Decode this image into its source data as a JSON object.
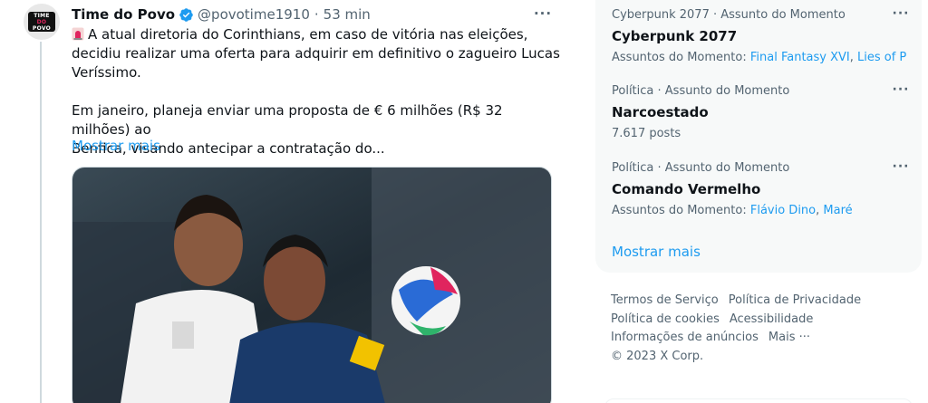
{
  "tweet": {
    "author_name": "Time do Povo",
    "handle": "@povotime1910",
    "separator": "·",
    "time": "53 min",
    "text_p1": "A atual diretoria do Corinthians, em caso de vitória nas eleições,\ndecidiu realizar uma oferta para adquirir em definitivo o zagueiro Lucas\nVeríssimo.",
    "text_p2": "Em janeiro, planeja enviar uma proposta de € 6 milhões (R$ 32 milhões) ao\nBenfica, visando antecipar a contratação do...",
    "show_more": "Mostrar mais",
    "more_icon": "more-horizontal-icon",
    "verified_icon": "verified-badge-icon",
    "alarm_icon": "rotating-light-icon",
    "avatar_lines": [
      "TIME",
      "DO",
      "POVO"
    ]
  },
  "trends": {
    "items": [
      {
        "meta": "Cyberpunk 2077 · Assunto do Momento",
        "title": "Cyberpunk 2077",
        "sub_prefix": "Assuntos do Momento: ",
        "links": [
          "Final Fantasy XVI",
          "Lies of P"
        ]
      },
      {
        "meta": "Política · Assunto do Momento",
        "title": "Narcoestado",
        "posts": "7.617 posts"
      },
      {
        "meta": "Política · Assunto do Momento",
        "title": "Comando Vermelho",
        "sub_prefix": "Assuntos do Momento: ",
        "links": [
          "Flávio Dino",
          "Maré"
        ]
      }
    ],
    "link_separator": ", ",
    "show_more": "Mostrar mais"
  },
  "footer": {
    "terms": "Termos de Serviço",
    "privacy": "Política de Privacidade",
    "cookies": "Política de cookies",
    "accessibility": "Acessibilidade",
    "ads": "Informações de anúncios",
    "more": "Mais ···",
    "copyright": "© 2023 X Corp."
  },
  "colors": {
    "accent": "#1d9bf0",
    "text_primary": "#0f1419",
    "text_secondary": "#536471",
    "panel_bg": "#f7f9f9"
  }
}
